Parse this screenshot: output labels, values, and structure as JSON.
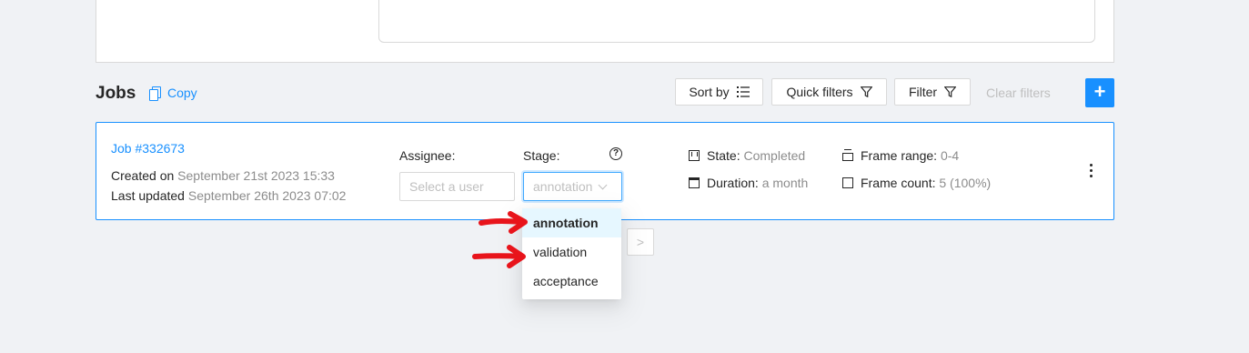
{
  "jobs_header": {
    "title": "Jobs",
    "copy_label": "Copy"
  },
  "toolbar": {
    "sort_label": "Sort by",
    "quick_filters_label": "Quick filters",
    "filter_label": "Filter",
    "clear_filters_label": "Clear filters",
    "add_label": "+"
  },
  "job": {
    "link": "Job #332673",
    "created_label": "Created on",
    "created_value": "September 21st 2023 15:33",
    "updated_label": "Last updated",
    "updated_value": "September 26th 2023 07:02",
    "assignee_label": "Assignee:",
    "assignee_placeholder": "Select a user",
    "stage_label": "Stage:",
    "stage_value": "annotation",
    "state_label": "State:",
    "state_value": "Completed",
    "duration_label": "Duration:",
    "duration_value": "a month",
    "frame_range_label": "Frame range:",
    "frame_range_value": "0-4",
    "frame_count_label": "Frame count:",
    "frame_count_value": "5 (100%)"
  },
  "stage_options": [
    "annotation",
    "validation",
    "acceptance"
  ],
  "pager": {
    "next": ">"
  },
  "colors": {
    "accent": "#1890ff",
    "annotation_arrow": "#e8141b"
  }
}
